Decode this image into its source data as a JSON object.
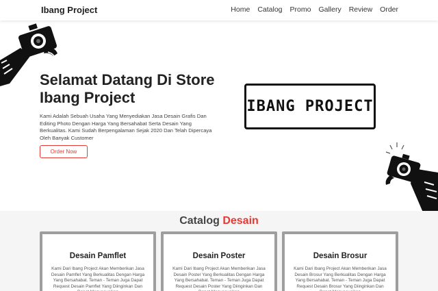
{
  "navbar": {
    "brand": "Ibang Project",
    "links": [
      "Home",
      "Catalog",
      "Promo",
      "Gallery",
      "Review",
      "Order"
    ]
  },
  "hero": {
    "title": "Selamat Datang Di Store Ibang Project",
    "description": "Kami Adalah Sebuah Usaha Yang Menyediakan Jasa Desain Grafis Dan Editing Photo Dengan Harga Yang Bersahabat Serta Desain Yang Berkualitas. Kami Sudah Berpengalaman Sejak 2020 Dan Telah Dipercaya Oleh Banyak Customer",
    "order_button": "Order Now",
    "logo_text": "IBANG PROJECT"
  },
  "catalog": {
    "title_main": "Catalog",
    "title_accent": "Desain",
    "cards": [
      {
        "title": "Desain Pamflet",
        "text": "Kami Dari Ibang Project Akan Memberikan Jasa Desain Pamflet Yang Berkualitas Dengan Harga Yang Bersahabat. Teman - Teman Juga Dapat Request Desain Pamflet Yang Diinginkan Dan Dapat Menyesuaikan"
      },
      {
        "title": "Desain Poster",
        "text": "Kami Dari Ibang Project Akan Memberikan Jasa Desain Poster Yang Berkualitas Dengan Harga Yang Bersahabat. Teman - Teman Juga Dapat Request Desain Poster Yang Diinginkan Dan Dapat Menyesuaikan"
      },
      {
        "title": "Desain Brosur",
        "text": "Kami Dari Ibang Project Akan Memberikan Jasa Desain Brosur Yang Berkualitas Dengan Harga Yang Bersahabat. Teman - Teman Juga Dapat Request Desain Brosur Yang Diinginkan Dan Dapat Menyesuaikan"
      }
    ]
  },
  "colors": {
    "accent": "#e53935",
    "card_border": "#9e9e9e",
    "background": "#f5f5f5"
  },
  "icons": [
    "camera-hand-icon",
    "camera-hand-icon"
  ]
}
